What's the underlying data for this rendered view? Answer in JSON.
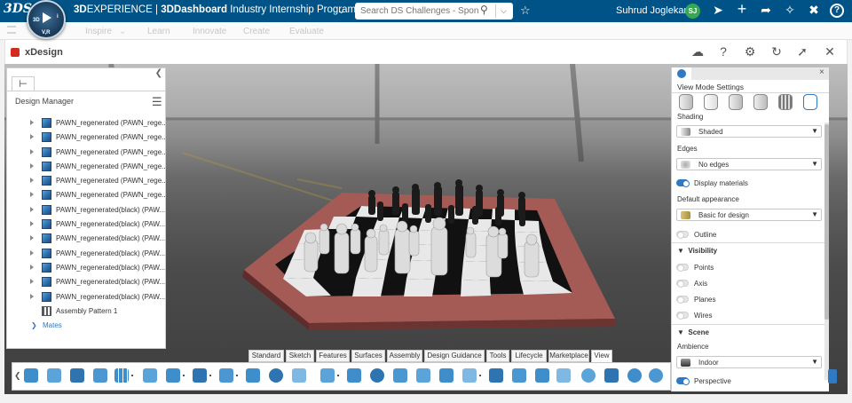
{
  "topbar": {
    "logo": "3DS",
    "compass": {
      "label_3d": "3D",
      "label_i": "i",
      "label_vr": "V,R"
    },
    "brand_prefix": "3D",
    "brand_rest": "EXPERIENCE | ",
    "brand_bold": "3D",
    "brand_dash": "Dashboard",
    "brand_context": "  Industry Internship Program - ...",
    "context_chevron": "⌄",
    "search_placeholder": "Search DS Challenges - Sponsors",
    "search_icon": "search-icon",
    "user_name": "Suhrud Joglekar",
    "user_initials": "SJ",
    "icons": [
      "tag-icon",
      "share-icon",
      "plus-icon",
      "forward-icon",
      "network-icon",
      "tools-icon",
      "help-icon"
    ]
  },
  "subbar": {
    "tabs": [
      "Inspire",
      "Learn",
      "Innovate",
      "Create",
      "Evaluate"
    ]
  },
  "widget": {
    "title": "xDesign",
    "header_icons": [
      "cloud-icon",
      "help-icon",
      "gear-icon",
      "refresh-icon",
      "pin-icon",
      "close-icon"
    ]
  },
  "design_manager": {
    "title": "Design Manager",
    "items": [
      {
        "label": "PAWN_regenerated (PAWN_rege...",
        "type": "part"
      },
      {
        "label": "PAWN_regenerated (PAWN_rege...",
        "type": "part"
      },
      {
        "label": "PAWN_regenerated (PAWN_rege...",
        "type": "part"
      },
      {
        "label": "PAWN_regenerated (PAWN_rege...",
        "type": "part"
      },
      {
        "label": "PAWN_regenerated (PAWN_rege...",
        "type": "part"
      },
      {
        "label": "PAWN_regenerated (PAWN_rege...",
        "type": "part"
      },
      {
        "label": "PAWN_regenerated(black) (PAW...",
        "type": "part"
      },
      {
        "label": "PAWN_regenerated(black) (PAW...",
        "type": "part"
      },
      {
        "label": "PAWN_regenerated(black) (PAW...",
        "type": "part"
      },
      {
        "label": "PAWN_regenerated(black) (PAW...",
        "type": "part"
      },
      {
        "label": "PAWN_regenerated(black) (PAW...",
        "type": "part"
      },
      {
        "label": "PAWN_regenerated(black) (PAW...",
        "type": "part"
      },
      {
        "label": "PAWN_regenerated(black) (PAW...",
        "type": "part"
      },
      {
        "label": "Assembly Pattern 1",
        "type": "pattern"
      },
      {
        "label": "Mates",
        "type": "mates"
      }
    ]
  },
  "view_mode": {
    "title": "View Mode Settings",
    "shading_label": "Shading",
    "shading_value": "Shaded",
    "edges_label": "Edges",
    "edges_value": "No edges",
    "display_materials": "Display materials",
    "default_appearance_label": "Default appearance",
    "default_appearance_value": "Basic for design",
    "outline": "Outline",
    "visibility_section": "Visibility",
    "points": "Points",
    "axis": "Axis",
    "planes": "Planes",
    "wires": "Wires",
    "scene_section": "Scene",
    "ambience_label": "Ambience",
    "ambience_value": "Indoor",
    "perspective": "Perspective",
    "dropdown_arrow": "▼",
    "collapse_arrow": "▼",
    "close": "×"
  },
  "action_bar": {
    "tabs": [
      "Standard",
      "Sketch",
      "Features",
      "Surfaces",
      "Assembly",
      "Design Guidance",
      "Tools",
      "Lifecycle",
      "Marketplace",
      "View"
    ],
    "active_tab": "View",
    "left_arrow": "❮"
  },
  "colors": {
    "topbar": "#005386",
    "accent": "#2f7ac2",
    "board_frame": "#a45a55",
    "avatar": "#34a853"
  }
}
